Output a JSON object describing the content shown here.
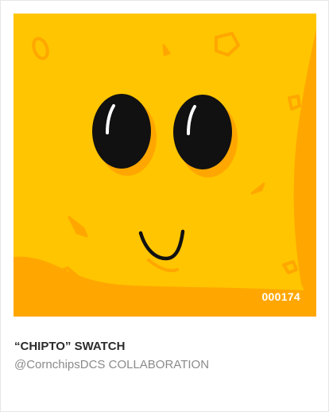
{
  "card": {
    "edition_number": "000174",
    "title": "“CHIPTO” SWATCH",
    "creator_handle": "@CornchipsDCS",
    "collection": "COLLABORATION"
  },
  "colors": {
    "chip_yellow": "#FFC500",
    "chip_shadow": "#FFA700",
    "eye": "#111111",
    "highlight": "#ffffff"
  },
  "icons": {
    "art": "chip-character-face"
  }
}
